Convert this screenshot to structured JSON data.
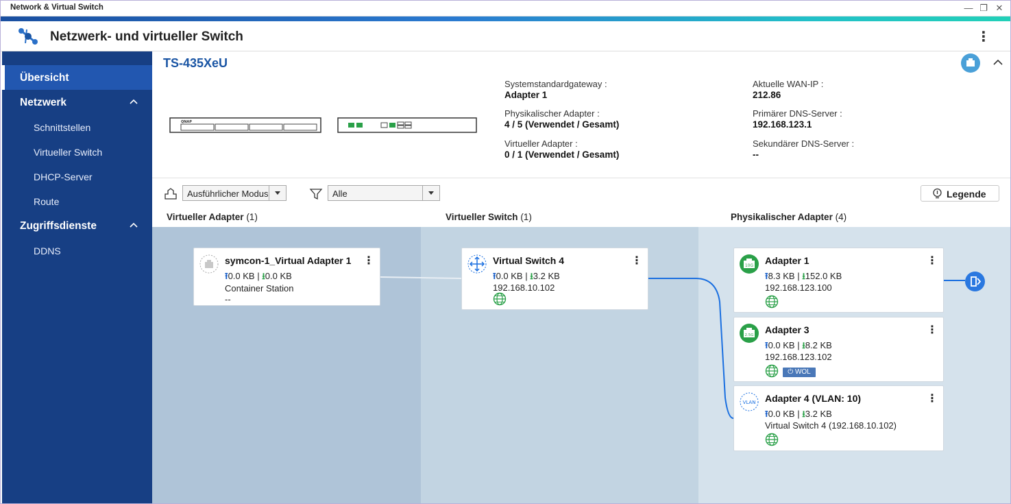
{
  "window": {
    "title": "Network & Virtual Switch",
    "minimize": "—",
    "maximize": "❐",
    "close": "✕"
  },
  "header": {
    "app_title": "Netzwerk- und virtueller Switch",
    "menu": "⋮"
  },
  "sidebar": {
    "items": [
      {
        "label": "Übersicht"
      },
      {
        "label": "Netzwerk"
      },
      {
        "label": "Schnittstellen"
      },
      {
        "label": "Virtueller Switch"
      },
      {
        "label": "DHCP-Server"
      },
      {
        "label": "Route"
      },
      {
        "label": "Zugriffsdienste"
      },
      {
        "label": "DDNS"
      }
    ]
  },
  "device": {
    "name": "TS-435XeU",
    "brand_mark": "QNAP",
    "gateway_label": "Systemstandardgateway :",
    "gateway_value": "Adapter 1",
    "phys_label": "Physikalischer Adapter :",
    "phys_value": "4 / 5 (Verwendet / Gesamt)",
    "virt_label": "Virtueller Adapter :",
    "virt_value": "0 / 1 (Verwendet / Gesamt)",
    "wan_label": "Aktuelle WAN-IP :",
    "wan_value": "212.86",
    "dns1_label": "Primärer DNS-Server :",
    "dns1_value": "192.168.123.1",
    "dns2_label": "Sekundärer DNS-Server :",
    "dns2_value": "--"
  },
  "toolbar": {
    "mode_value": "Ausführlicher Modus",
    "filter_value": "Alle",
    "legend_label": "Legende"
  },
  "columns": {
    "virtual_adapter": {
      "label": "Virtueller Adapter",
      "count": "(1)"
    },
    "virtual_switch": {
      "label": "Virtueller Switch",
      "count": "(1)"
    },
    "physical_adapter": {
      "label": "Physikalischer Adapter",
      "count": "(4)"
    }
  },
  "cards": {
    "vadapter": {
      "title": "symcon-1_Virtual Adapter 1",
      "up": "0.0 KB",
      "sep": " | ",
      "down": "0.0 KB",
      "line3": "Container Station",
      "line4": "--"
    },
    "vswitch": {
      "title": "Virtual Switch 4",
      "up": "0.0 KB",
      "sep": " | ",
      "down": "3.2 KB",
      "line3": "192.168.10.102"
    },
    "adapter1": {
      "title": "Adapter 1",
      "badge": "10G",
      "up": "8.3 KB",
      "sep": " | ",
      "down": "152.0 KB",
      "line3": "192.168.123.100"
    },
    "adapter3": {
      "title": "Adapter 3",
      "badge": "2.5G",
      "up": "0.0 KB",
      "sep": " | ",
      "down": "8.2 KB",
      "line3": "192.168.123.102",
      "wol": "⏻ WOL"
    },
    "adapter4": {
      "title": "Adapter 4 (VLAN: 10)",
      "badge": "VLAN",
      "up": "0.0 KB",
      "sep": " | ",
      "down": "3.2 KB",
      "line3": "Virtual Switch 4 (192.168.10.102)"
    }
  },
  "arrows": {
    "up": "⭱",
    "down": "⭳"
  },
  "colors": {
    "sidebar": "#173f84",
    "sidebar_active": "#2257b0",
    "accent_blue": "#1a55a4",
    "link_line": "#1a6fe0",
    "status_green": "#2aa048"
  }
}
